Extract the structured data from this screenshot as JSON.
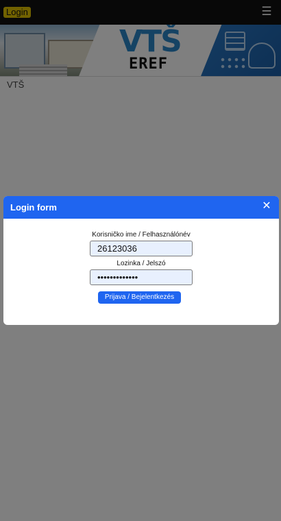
{
  "topbar": {
    "login_label": "Login",
    "menu_icon": "hamburger-menu-icon"
  },
  "banner": {
    "logo_text": "VTŠ",
    "logo_subtext": "EREF"
  },
  "site": {
    "name": "VTŠ"
  },
  "modal": {
    "title": "Login form",
    "close_icon": "close-icon",
    "username_label": "Korisničko ime / Felhasználónév",
    "username_value": "26123036",
    "password_label": "Lozinka / Jelszó",
    "password_value": "•••••••••••••",
    "submit_label": "Prijava / Bejelentkezés"
  },
  "colors": {
    "topbar": "#111111",
    "login_pill": "#e3c500",
    "primary": "#1f65f0",
    "input_bg": "#e8f0fe",
    "logo_blue": "#2b86c8"
  }
}
